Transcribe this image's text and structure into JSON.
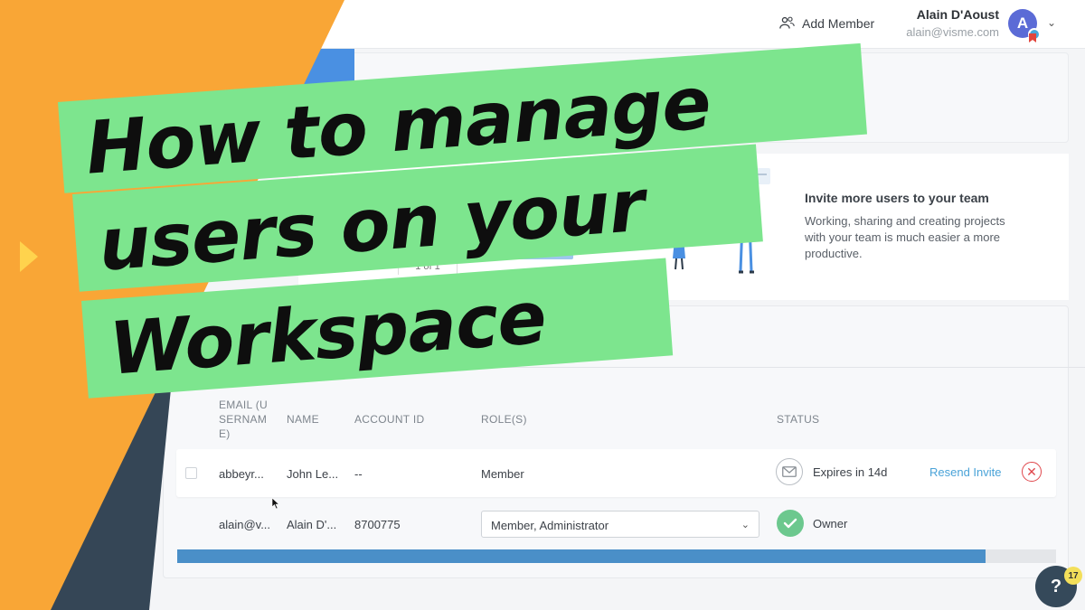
{
  "header": {
    "add_member_label": "Add Member",
    "user_name": "Alain D'Aoust",
    "user_email": "alain@visme.com",
    "avatar_initial": "A"
  },
  "invite": {
    "title": "Invite more users to your team",
    "description": "Working, sharing and creating projects with your team is much easier a more productive.",
    "pager": "1 of 1"
  },
  "table": {
    "headers": {
      "email": "EMAIL (USERNAME)",
      "name": "NAME",
      "account_id": "ACCOUNT ID",
      "roles": "ROLE(S)",
      "status": "STATUS"
    },
    "rows": [
      {
        "email": "abbeyr...",
        "name": "John Le...",
        "account_id": "--",
        "role": "Member",
        "status": "Expires in 14d",
        "action": "Resend Invite"
      },
      {
        "email": "alain@v...",
        "name": "Alain D'...",
        "account_id": "8700775",
        "role": "Member, Administrator",
        "status": "Owner"
      }
    ],
    "progress": 0.92
  },
  "help": {
    "label": "?",
    "badge_count": "17"
  },
  "overlay": {
    "line1": "How to manage",
    "line2": "users on your",
    "line3": "Workspace"
  },
  "colors": {
    "orange": "#f9a636",
    "navy": "#354656",
    "green_banner": "#7de58e",
    "accent_blue": "#4a90e2"
  }
}
